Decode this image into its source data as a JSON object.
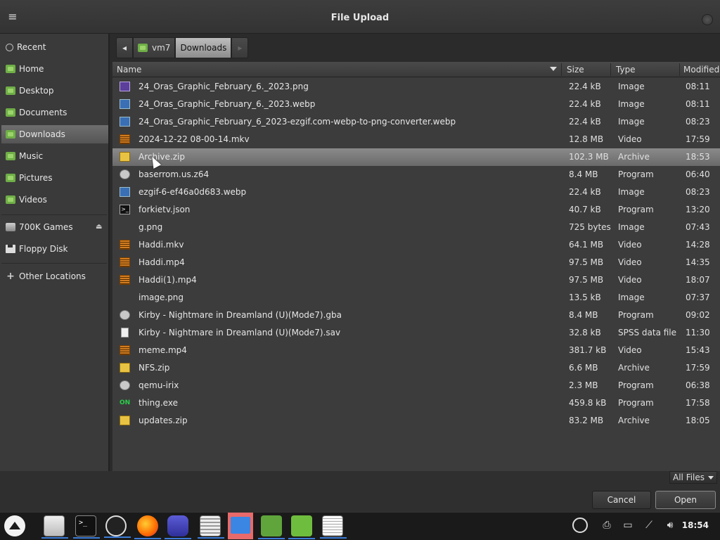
{
  "window": {
    "title": "File Upload"
  },
  "sidebar": {
    "places": [
      {
        "label": "Recent",
        "icon": "clock-icon"
      },
      {
        "label": "Home",
        "icon": "home-folder-icon"
      },
      {
        "label": "Desktop",
        "icon": "desktop-folder-icon"
      },
      {
        "label": "Documents",
        "icon": "documents-folder-icon"
      },
      {
        "label": "Downloads",
        "icon": "downloads-folder-icon",
        "active": true
      },
      {
        "label": "Music",
        "icon": "music-folder-icon"
      },
      {
        "label": "Pictures",
        "icon": "pictures-folder-icon"
      },
      {
        "label": "Videos",
        "icon": "videos-folder-icon"
      }
    ],
    "devices": [
      {
        "label": "700K Games",
        "icon": "drive-icon"
      },
      {
        "label": "Floppy Disk",
        "icon": "floppy-icon"
      }
    ],
    "other": {
      "label": "Other Locations",
      "icon": "plus-icon"
    }
  },
  "pathbar": {
    "segments": [
      "vm7",
      "Downloads"
    ]
  },
  "columns": {
    "name": "Name",
    "size": "Size",
    "type": "Type",
    "modified": "Modified"
  },
  "files": [
    {
      "name": "24_Oras_Graphic_February_6._2023.png",
      "size": "22.4 kB",
      "type": "Image",
      "modified": "08:11",
      "icon": "image"
    },
    {
      "name": "24_Oras_Graphic_February_6._2023.webp",
      "size": "22.4 kB",
      "type": "Image",
      "modified": "08:11",
      "icon": "image"
    },
    {
      "name": "24_Oras_Graphic_February_6_2023-ezgif.com-webp-to-png-converter.webp",
      "size": "22.4 kB",
      "type": "Image",
      "modified": "08:23",
      "icon": "image"
    },
    {
      "name": "2024-12-22 08-00-14.mkv",
      "size": "12.8 MB",
      "type": "Video",
      "modified": "17:59",
      "icon": "video"
    },
    {
      "name": "Archive.zip",
      "size": "102.3 MB",
      "type": "Archive",
      "modified": "18:53",
      "icon": "archive",
      "selected": true
    },
    {
      "name": "baserrom.us.z64",
      "size": "8.4 MB",
      "type": "Program",
      "modified": "06:40",
      "icon": "program"
    },
    {
      "name": "ezgif-6-ef46a0d683.webp",
      "size": "22.4 kB",
      "type": "Image",
      "modified": "08:23",
      "icon": "image"
    },
    {
      "name": "forkietv.json",
      "size": "40.7 kB",
      "type": "Program",
      "modified": "13:20",
      "icon": "terminal"
    },
    {
      "name": "g.png",
      "size": "725 bytes",
      "type": "Image",
      "modified": "07:43",
      "icon": "blank"
    },
    {
      "name": "Haddi.mkv",
      "size": "64.1 MB",
      "type": "Video",
      "modified": "14:28",
      "icon": "video"
    },
    {
      "name": "Haddi.mp4",
      "size": "97.5 MB",
      "type": "Video",
      "modified": "14:35",
      "icon": "video"
    },
    {
      "name": "Haddi(1).mp4",
      "size": "97.5 MB",
      "type": "Video",
      "modified": "18:07",
      "icon": "video"
    },
    {
      "name": "image.png",
      "size": "13.5 kB",
      "type": "Image",
      "modified": "07:37",
      "icon": "blank"
    },
    {
      "name": "Kirby - Nightmare in Dreamland (U)(Mode7).gba",
      "size": "8.4 MB",
      "type": "Program",
      "modified": "09:02",
      "icon": "program"
    },
    {
      "name": "Kirby - Nightmare in Dreamland (U)(Mode7).sav",
      "size": "32.8 kB",
      "type": "SPSS data file",
      "modified": "11:30",
      "icon": "document"
    },
    {
      "name": "meme.mp4",
      "size": "381.7 kB",
      "type": "Video",
      "modified": "15:43",
      "icon": "video"
    },
    {
      "name": "NFS.zip",
      "size": "6.6 MB",
      "type": "Archive",
      "modified": "17:59",
      "icon": "archive"
    },
    {
      "name": "qemu-irix",
      "size": "2.3 MB",
      "type": "Program",
      "modified": "06:38",
      "icon": "program"
    },
    {
      "name": "thing.exe",
      "size": "459.8 kB",
      "type": "Program",
      "modified": "17:58",
      "icon": "exe"
    },
    {
      "name": "updates.zip",
      "size": "83.2 MB",
      "type": "Archive",
      "modified": "18:05",
      "icon": "archive"
    }
  ],
  "filter": {
    "selected": "All Files"
  },
  "buttons": {
    "cancel": "Cancel",
    "open": "Open"
  },
  "taskbar": {
    "clock": "18:54",
    "term_glyph": ">_",
    "exe_glyph": "ON"
  }
}
